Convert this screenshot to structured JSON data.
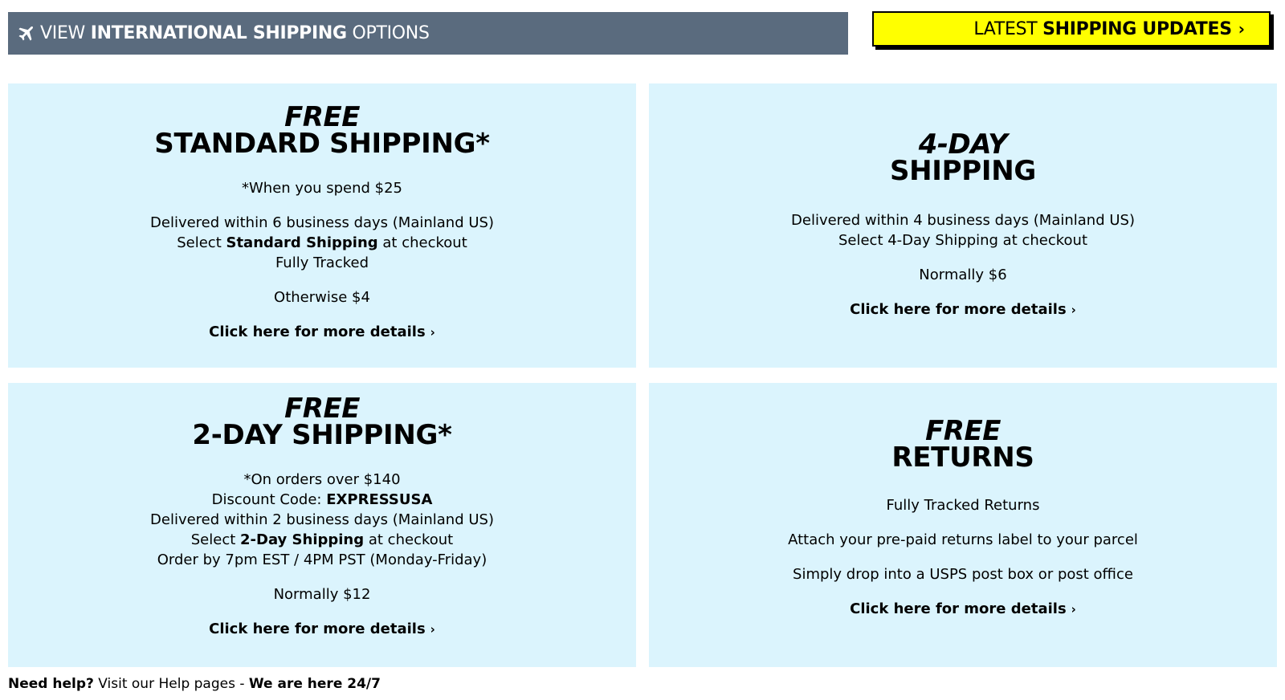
{
  "intl_bar": {
    "prefix": "VIEW",
    "bold": "INTERNATIONAL SHIPPING",
    "suffix": "OPTIONS",
    "icon": "plane-icon"
  },
  "updates": {
    "prefix": "LATEST",
    "bold": "SHIPPING UPDATES",
    "chevron": "›",
    "bg_color": "#ffff00"
  },
  "colors": {
    "card_bg": "#dbf4fd",
    "bar_bg": "#5a6b7e"
  },
  "cards": {
    "standard": {
      "free": "FREE",
      "title": "STANDARD SHIPPING*",
      "note": "*When you spend $25",
      "line1": "Delivered within 6 business days (Mainland US)",
      "select_pre": "Select",
      "select_bold": "Standard Shipping",
      "select_post": "at checkout",
      "line3": "Fully Tracked",
      "price": "Otherwise $4",
      "details": "Click here for more details"
    },
    "four_day": {
      "title1": "4-DAY",
      "title2": "SHIPPING",
      "line1": "Delivered within 4 business days (Mainland US)",
      "line2": "Select 4-Day Shipping at checkout",
      "price": "Normally $6",
      "details": "Click here for more details"
    },
    "two_day": {
      "free": "FREE",
      "title": "2-DAY SHIPPING*",
      "note": "*On orders over $140",
      "code_pre": "Discount Code:",
      "code": "EXPRESSUSA",
      "line1": "Delivered within 2 business days (Mainland US)",
      "select_pre": "Select",
      "select_bold": "2-Day Shipping",
      "select_post": "at checkout",
      "line3": "Order by 7pm EST / 4PM PST (Monday-Friday)",
      "price": "Normally $12",
      "details": "Click here for more details"
    },
    "returns": {
      "free": "FREE",
      "title": "RETURNS",
      "line1": "Fully Tracked Returns",
      "line2": "Attach your pre-paid returns label to your parcel",
      "line3": "Simply drop into a USPS post box or post office",
      "details": "Click here for more details"
    }
  },
  "footer": {
    "need_help": "Need help?",
    "visit": "Visit our Help pages -",
    "here": "We are here 24/7"
  }
}
